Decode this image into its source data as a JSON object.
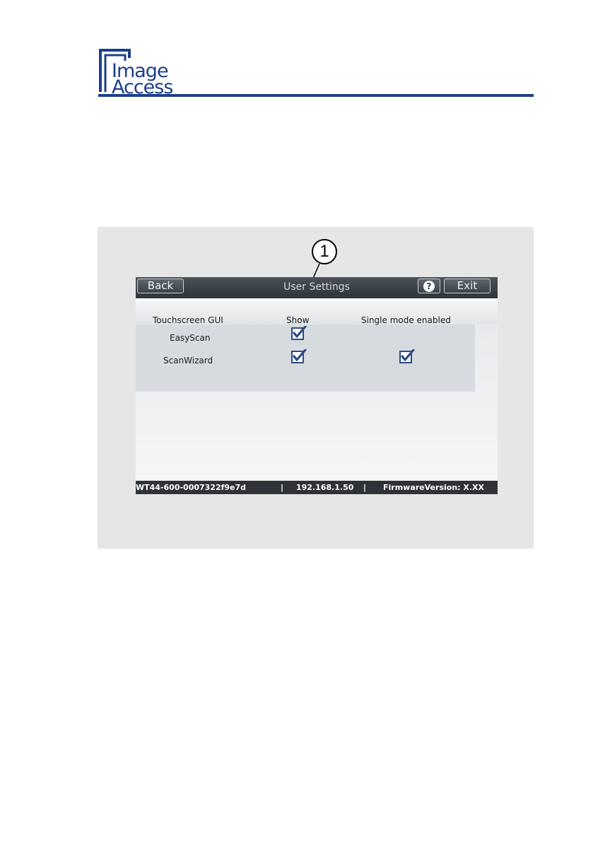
{
  "logo": {
    "line1": "Image",
    "line2": "Access",
    "brand_color": "#1d3f8a"
  },
  "callout": {
    "number": "1"
  },
  "screen": {
    "title": "User Settings",
    "back_label": "Back",
    "help_label": "?",
    "exit_label": "Exit",
    "columns": [
      "Touchscreen GUI",
      "Show",
      "Single mode enabled"
    ],
    "rows": [
      {
        "label": "EasyScan",
        "show": true,
        "single_mode": null
      },
      {
        "label": "ScanWizard",
        "show": true,
        "single_mode": true
      }
    ],
    "status": {
      "serial": "WT44-600-0007322f9e7d",
      "separator": "|",
      "ip": "192.168.1.50",
      "firmware": "FirmwareVersion: X.XX"
    }
  },
  "icons": {
    "checkbox": "checkbox-checked-icon",
    "help": "help-icon"
  }
}
